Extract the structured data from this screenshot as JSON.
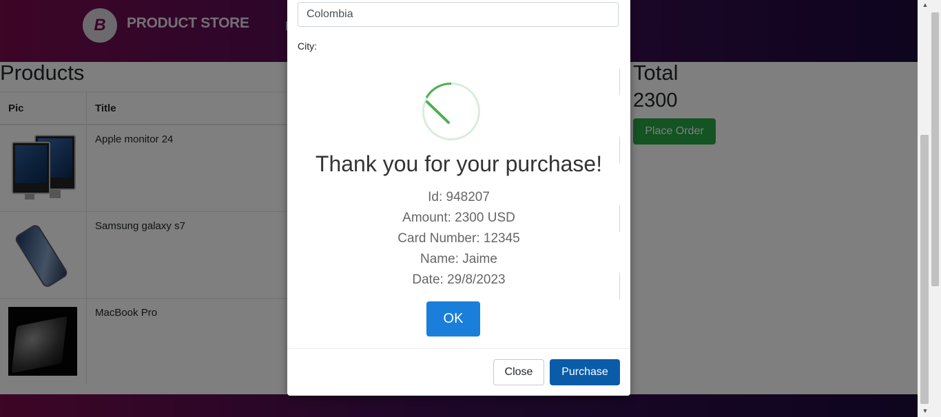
{
  "navbar": {
    "brand_logo_letter": "B",
    "brand_name": "PRODUCT STORE",
    "nav_partial": "H"
  },
  "products": {
    "heading": "Products",
    "columns": [
      "Pic",
      "Title"
    ],
    "rows": [
      {
        "title": "Apple monitor 24",
        "image_icon": "apple-monitor-image"
      },
      {
        "title": "Samsung galaxy s7",
        "image_icon": "samsung-phone-image"
      },
      {
        "title": "MacBook Pro",
        "image_icon": "macbook-image"
      }
    ]
  },
  "cart": {
    "total_heading": "Total",
    "total_value": "2300",
    "place_order_label": "Place Order"
  },
  "order_modal": {
    "country_value": "Colombia",
    "city_label": "City:",
    "close_label": "Close",
    "purchase_label": "Purchase"
  },
  "alert": {
    "icon": "success-check-icon",
    "accent_color": "#4caf50",
    "title": "Thank you for your purchase!",
    "lines": [
      "Id: 948207",
      "Amount: 2300 USD",
      "Card Number: 12345",
      "Name: Jaime",
      "Date: 29/8/2023"
    ],
    "ok_label": "OK"
  },
  "scrollbar": {
    "up_arrow": "▲",
    "down_arrow": "▼"
  }
}
